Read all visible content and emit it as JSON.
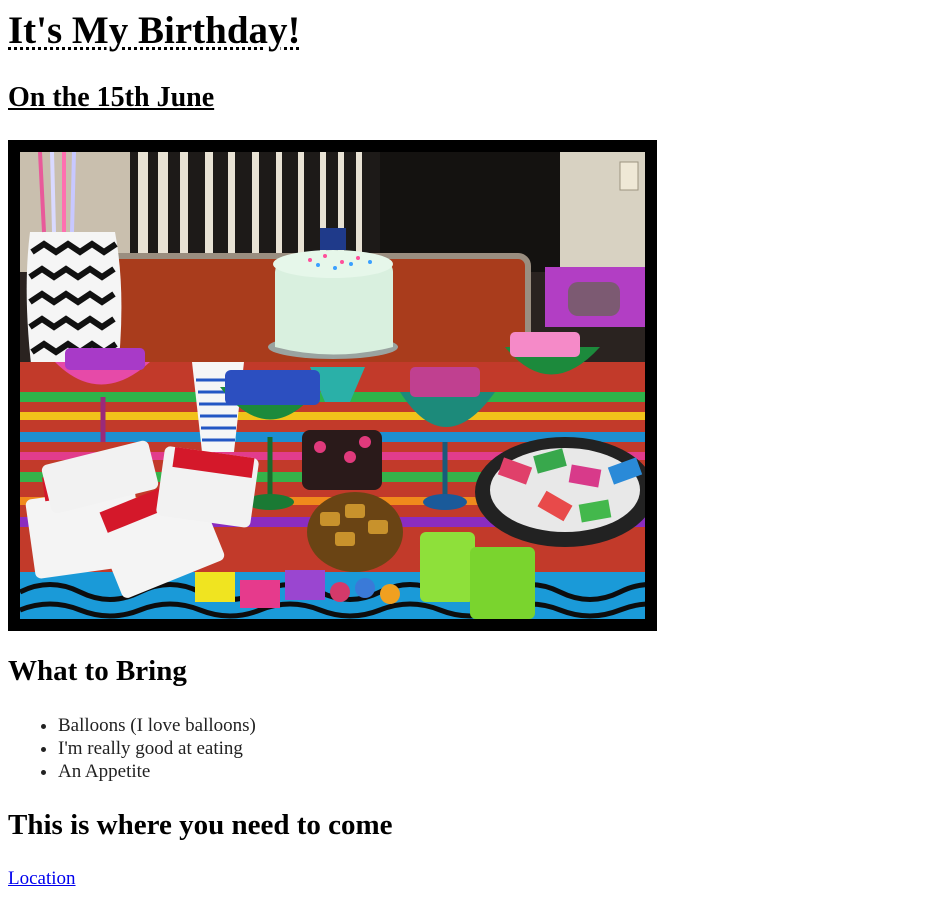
{
  "header": {
    "title": "It's My Birthday!",
    "subtitle": "On the 15th June"
  },
  "photo": {
    "image": "birthday party table with cake and candy"
  },
  "bring": {
    "heading": "What to Bring",
    "items": [
      "Balloons (I love balloons)",
      "I'm really good at eating",
      "An Appetite"
    ]
  },
  "where": {
    "heading": "This is where you need to come",
    "link_label": "Location"
  }
}
